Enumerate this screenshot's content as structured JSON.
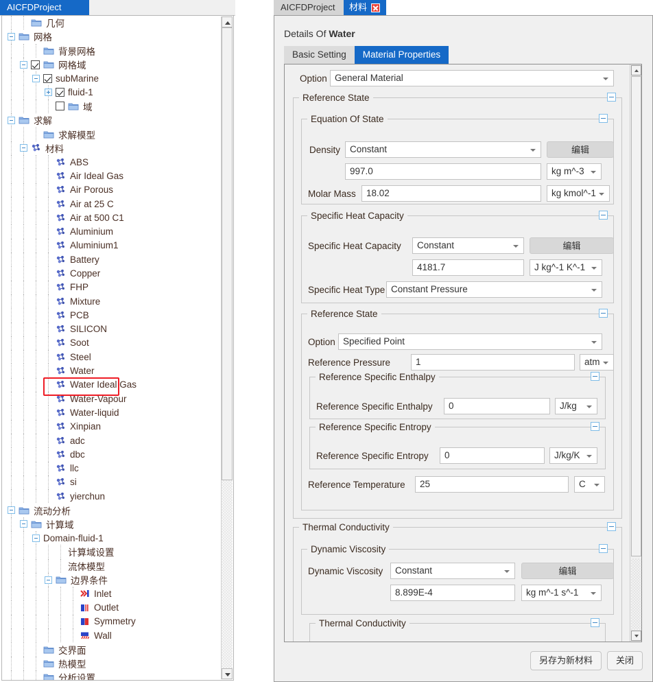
{
  "left": {
    "tab_label": "AICFDProject",
    "tree": [
      {
        "indent": 2,
        "exp": null,
        "check": null,
        "icon": "folder",
        "label": "几何"
      },
      {
        "indent": 1,
        "exp": "minus",
        "check": null,
        "icon": "folder",
        "label": "网格"
      },
      {
        "indent": 3,
        "exp": null,
        "check": null,
        "icon": "folder",
        "label": "背景网格"
      },
      {
        "indent": 2,
        "exp": "minus",
        "check": "on",
        "icon": "folder",
        "label": "网格域"
      },
      {
        "indent": 3,
        "exp": "minus",
        "check": "on",
        "icon": null,
        "label": "subMarine"
      },
      {
        "indent": 4,
        "exp": "plus",
        "check": "on",
        "icon": null,
        "label": "fluid-1"
      },
      {
        "indent": 4,
        "exp": null,
        "check": "off",
        "icon": "folder",
        "label": "域"
      },
      {
        "indent": 1,
        "exp": "minus",
        "check": null,
        "icon": "folder",
        "label": "求解"
      },
      {
        "indent": 3,
        "exp": null,
        "check": null,
        "icon": "folder",
        "label": "求解模型"
      },
      {
        "indent": 2,
        "exp": "minus",
        "check": null,
        "icon": "material",
        "label": "材料"
      },
      {
        "indent": 4,
        "exp": null,
        "check": null,
        "icon": "material",
        "label": "ABS"
      },
      {
        "indent": 4,
        "exp": null,
        "check": null,
        "icon": "material",
        "label": "Air Ideal Gas"
      },
      {
        "indent": 4,
        "exp": null,
        "check": null,
        "icon": "material",
        "label": "Air Porous"
      },
      {
        "indent": 4,
        "exp": null,
        "check": null,
        "icon": "material",
        "label": "Air at 25 C"
      },
      {
        "indent": 4,
        "exp": null,
        "check": null,
        "icon": "material",
        "label": "Air at 500 C1"
      },
      {
        "indent": 4,
        "exp": null,
        "check": null,
        "icon": "material",
        "label": "Aluminium"
      },
      {
        "indent": 4,
        "exp": null,
        "check": null,
        "icon": "material",
        "label": "Aluminium1"
      },
      {
        "indent": 4,
        "exp": null,
        "check": null,
        "icon": "material",
        "label": "Battery"
      },
      {
        "indent": 4,
        "exp": null,
        "check": null,
        "icon": "material",
        "label": "Copper"
      },
      {
        "indent": 4,
        "exp": null,
        "check": null,
        "icon": "material",
        "label": "FHP"
      },
      {
        "indent": 4,
        "exp": null,
        "check": null,
        "icon": "material",
        "label": "Mixture"
      },
      {
        "indent": 4,
        "exp": null,
        "check": null,
        "icon": "material",
        "label": "PCB"
      },
      {
        "indent": 4,
        "exp": null,
        "check": null,
        "icon": "material",
        "label": "SILICON"
      },
      {
        "indent": 4,
        "exp": null,
        "check": null,
        "icon": "material",
        "label": "Soot"
      },
      {
        "indent": 4,
        "exp": null,
        "check": null,
        "icon": "material",
        "label": "Steel"
      },
      {
        "indent": 4,
        "exp": null,
        "check": null,
        "icon": "material",
        "label": "Water",
        "selected": true
      },
      {
        "indent": 4,
        "exp": null,
        "check": null,
        "icon": "material",
        "label": "Water Ideal Gas"
      },
      {
        "indent": 4,
        "exp": null,
        "check": null,
        "icon": "material",
        "label": "Water-Vapour"
      },
      {
        "indent": 4,
        "exp": null,
        "check": null,
        "icon": "material",
        "label": "Water-liquid"
      },
      {
        "indent": 4,
        "exp": null,
        "check": null,
        "icon": "material",
        "label": "Xinpian"
      },
      {
        "indent": 4,
        "exp": null,
        "check": null,
        "icon": "material",
        "label": "adc"
      },
      {
        "indent": 4,
        "exp": null,
        "check": null,
        "icon": "material",
        "label": "dbc"
      },
      {
        "indent": 4,
        "exp": null,
        "check": null,
        "icon": "material",
        "label": "llc"
      },
      {
        "indent": 4,
        "exp": null,
        "check": null,
        "icon": "material",
        "label": "si"
      },
      {
        "indent": 4,
        "exp": null,
        "check": null,
        "icon": "material",
        "label": "yierchun"
      },
      {
        "indent": 1,
        "exp": "minus",
        "check": null,
        "icon": "folder",
        "label": "流动分析"
      },
      {
        "indent": 2,
        "exp": "minus",
        "check": null,
        "icon": "folder",
        "label": "计算域"
      },
      {
        "indent": 3,
        "exp": "minus",
        "check": null,
        "icon": null,
        "label": "Domain-fluid-1"
      },
      {
        "indent": 5,
        "exp": null,
        "check": null,
        "icon": null,
        "label": "计算域设置"
      },
      {
        "indent": 5,
        "exp": null,
        "check": null,
        "icon": null,
        "label": "流体模型"
      },
      {
        "indent": 4,
        "exp": "minus",
        "check": null,
        "icon": "folder",
        "label": "边界条件"
      },
      {
        "indent": 6,
        "exp": null,
        "check": null,
        "icon": "inlet",
        "label": "Inlet"
      },
      {
        "indent": 6,
        "exp": null,
        "check": null,
        "icon": "outlet",
        "label": "Outlet"
      },
      {
        "indent": 6,
        "exp": null,
        "check": null,
        "icon": "symmetry",
        "label": "Symmetry"
      },
      {
        "indent": 6,
        "exp": null,
        "check": null,
        "icon": "wall",
        "label": "Wall"
      },
      {
        "indent": 3,
        "exp": null,
        "check": null,
        "icon": "folder",
        "label": "交界面"
      },
      {
        "indent": 3,
        "exp": null,
        "check": null,
        "icon": "folder",
        "label": "热模型"
      },
      {
        "indent": 3,
        "exp": null,
        "check": null,
        "icon": "folder",
        "label": "分析设置"
      }
    ]
  },
  "right": {
    "tabs": {
      "project": "AICFDProject",
      "material": "材料"
    },
    "details_prefix": "Details Of",
    "details_name": "Water",
    "subtabs": {
      "basic": "Basic Setting",
      "properties": "Material Properties"
    },
    "option_label": "Option",
    "option_value": "General Material",
    "groups": {
      "reference_state_outer": "Reference State",
      "equation_of_state": "Equation Of State",
      "specific_heat_capacity": "Specific Heat Capacity",
      "reference_state_inner": "Reference State",
      "reference_specific_enthalpy": "Reference Specific Enthalpy",
      "reference_specific_entropy": "Reference Specific Entropy",
      "thermal_conductivity_outer": "Thermal Conductivity",
      "dynamic_viscosity": "Dynamic Viscosity",
      "thermal_conductivity_inner": "Thermal Conductivity"
    },
    "fields": {
      "density_label": "Density",
      "density_mode": "Constant",
      "density_value": "997.0",
      "density_unit": "kg m^-3",
      "molar_mass_label": "Molar Mass",
      "molar_mass_value": "18.02",
      "molar_mass_unit": "kg kmol^-1",
      "shc_label": "Specific Heat Capacity",
      "shc_mode": "Constant",
      "shc_value": "4181.7",
      "shc_unit": "J kg^-1 K^-1",
      "sht_label": "Specific Heat Type",
      "sht_value": "Constant Pressure",
      "ref_option_label": "Option",
      "ref_option_value": "Specified Point",
      "ref_pressure_label": "Reference Pressure",
      "ref_pressure_value": "1",
      "ref_pressure_unit": "atm",
      "ref_enthalpy_label": "Reference Specific Enthalpy",
      "ref_enthalpy_value": "0",
      "ref_enthalpy_unit": "J/kg",
      "ref_entropy_label": "Reference Specific Entropy",
      "ref_entropy_value": "0",
      "ref_entropy_unit": "J/kg/K",
      "ref_temp_label": "Reference Temperature",
      "ref_temp_value": "25",
      "ref_temp_unit": "C",
      "dv_label": "Dynamic Viscosity",
      "dv_mode": "Constant",
      "dv_value": "8.899E-4",
      "dv_unit": "kg m^-1 s^-1",
      "edit_button": "编辑"
    },
    "footer": {
      "save_as_new": "另存为新材料",
      "close": "关闭"
    }
  },
  "colors": {
    "accent": "#1569c7",
    "selection_red": "#ee1c25",
    "tree_text": "#4a2f25"
  }
}
